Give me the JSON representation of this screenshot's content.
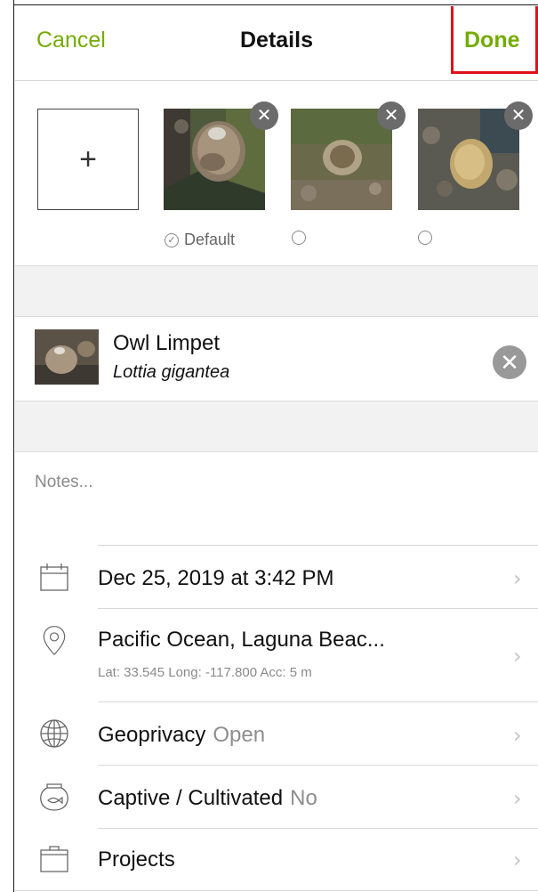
{
  "nav": {
    "cancel": "Cancel",
    "title": "Details",
    "done": "Done"
  },
  "photos": {
    "add_label": "+",
    "remove_glyph": "✕",
    "default_label": "Default",
    "default_check": "✓",
    "items": [
      {
        "is_default": true
      },
      {
        "is_default": false
      },
      {
        "is_default": false
      }
    ]
  },
  "taxon": {
    "common_name": "Owl Limpet",
    "scientific_name": "Lottia gigantea",
    "clear_glyph": "✕"
  },
  "notes": {
    "placeholder": "Notes..."
  },
  "rows": {
    "date": {
      "label": "Dec 25, 2019 at 3:42 PM",
      "icon": "calendar-icon"
    },
    "location": {
      "label": "Pacific Ocean, Laguna Beac...",
      "detail": "Lat: 33.545  Long: -117.800  Acc: 5 m",
      "icon": "location-pin-icon"
    },
    "geoprivacy": {
      "label": "Geoprivacy",
      "value": "Open",
      "icon": "globe-icon"
    },
    "captive": {
      "label": "Captive / Cultivated",
      "value": "No",
      "icon": "fishbowl-icon"
    },
    "projects": {
      "label": "Projects",
      "icon": "briefcase-icon"
    },
    "chevron": "›"
  },
  "colors": {
    "accent": "#74ac00",
    "highlight_box": "#e0101a",
    "band": "#f2f2f2"
  }
}
